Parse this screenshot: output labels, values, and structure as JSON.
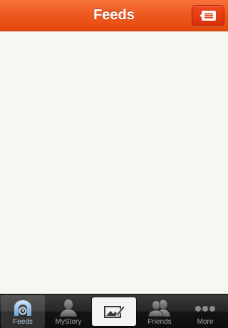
{
  "navbar": {
    "title": "Feeds",
    "right_button_icon": "message-icon"
  },
  "tabbar": {
    "tabs": [
      {
        "label": "Feeds",
        "icon": "feeds-icon",
        "active": true
      },
      {
        "label": "MyStory",
        "icon": "person-icon",
        "active": false
      },
      {
        "label": "",
        "icon": "compose-icon",
        "active": false
      },
      {
        "label": "Friends",
        "icon": "friends-icon",
        "active": false
      },
      {
        "label": "More",
        "icon": "more-dots-icon",
        "active": false
      }
    ]
  },
  "colors": {
    "navbar_accent": "#ee5a21",
    "content_background": "#f7f7f1",
    "tabbar_background": "#1a1a1a"
  }
}
